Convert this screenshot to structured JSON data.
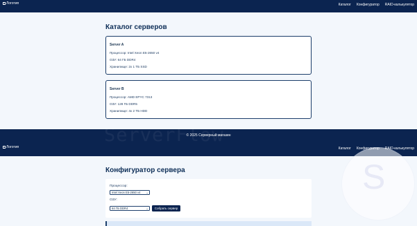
{
  "header_top": {
    "logo_text": "Логотип",
    "nav": [
      {
        "label": "Каталог"
      },
      {
        "label": "Конфигуратор"
      },
      {
        "label": "RAID-калькулятор"
      }
    ]
  },
  "catalog": {
    "title": "Каталог серверов",
    "cards": [
      {
        "name": "Server A",
        "cpu": "Процессор: Intel Xeon E5-2650 v4",
        "ram": "ОЗУ: 64 ГБ DDR4",
        "storage": "Хранилище: 2x 1 ТБ SSD"
      },
      {
        "name": "Server B",
        "cpu": "Процессор: AMD EPYC 7313",
        "ram": "ОЗУ: 128 ГБ DDR5",
        "storage": "Хранилище: 4x 2 ТБ HDD"
      }
    ]
  },
  "footer": {
    "copyright": "© 2025 Серверный магазин",
    "watermark": "ServerFlow"
  },
  "header_second": {
    "logo_text": "Логотип",
    "nav": [
      {
        "label": "Каталог"
      },
      {
        "label": "Конфигуратор"
      },
      {
        "label": "RAID-калькулятор"
      }
    ]
  },
  "configurator": {
    "title": "Конфигуратор сервера",
    "cpu_label": "Процессор:",
    "cpu_value": "Intel Xeon E5-2650 v4",
    "ram_label": "ОЗУ:",
    "ram_value": "64 ГБ DDR4",
    "button_label": "Собрать сервер",
    "bg_letter": "S"
  },
  "icons": {
    "logo": "image-icon",
    "select_arrow": "chevron-down-icon"
  }
}
